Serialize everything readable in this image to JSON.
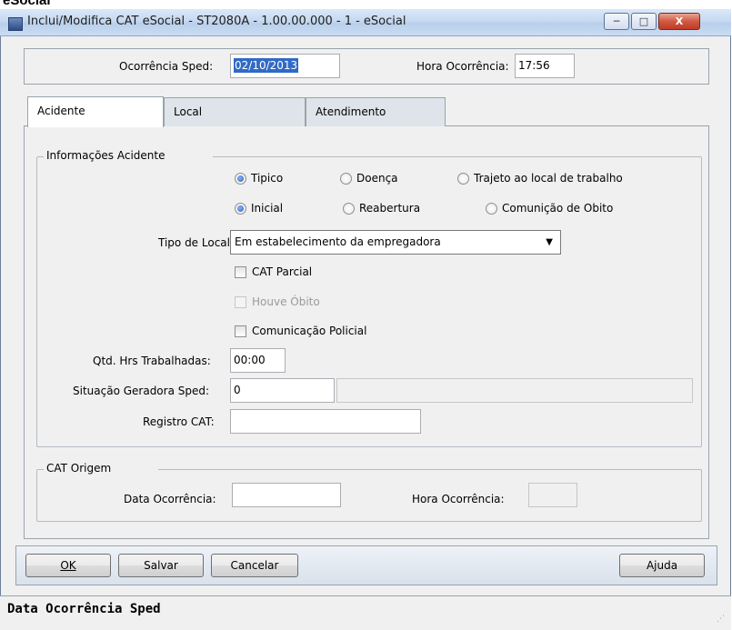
{
  "cut_top_text": "eSocial",
  "window": {
    "title": "Inclui/Modifica CAT eSocial - ST2080A - 1.00.00.000 - 1 - eSocial",
    "minimize": "─",
    "maximize": "□",
    "close": "X"
  },
  "header": {
    "ocorrencia_label": "Ocorrência Sped:",
    "ocorrencia_value": "02/10/2013",
    "hora_label": "Hora Ocorrência:",
    "hora_value": "17:56"
  },
  "tabs": [
    {
      "label": "Acidente",
      "active": true
    },
    {
      "label": "Local",
      "active": false
    },
    {
      "label": "Atendimento",
      "active": false
    }
  ],
  "acidente": {
    "legend": "Informações Acidente",
    "radios_tipo": [
      {
        "label": "Tipico",
        "checked": true
      },
      {
        "label": "Doença",
        "checked": false
      },
      {
        "label": "Trajeto ao local de trabalho",
        "checked": false
      }
    ],
    "radios_cat": [
      {
        "label": "Inicial",
        "checked": true
      },
      {
        "label": "Reabertura",
        "checked": false
      },
      {
        "label": "Comunição de Obito",
        "checked": false
      }
    ],
    "tipo_local_label": "Tipo de Local:",
    "tipo_local_value": "Em estabelecimento da empregadora",
    "cat_parcial": "CAT Parcial",
    "houve_obito": "Houve Óbito",
    "comunicacao_policial": "Comunicação Policial",
    "qtd_hrs_label": "Qtd. Hrs Trabalhadas:",
    "qtd_hrs_value": "00:00",
    "situacao_label": "Situação Geradora Sped:",
    "situacao_value": "0",
    "situacao_desc": "",
    "registro_label": "Registro CAT:",
    "registro_value": ""
  },
  "cat_origem": {
    "legend": "CAT Origem",
    "data_label": "Data Ocorrência:",
    "data_value": "",
    "hora_label": "Hora Ocorrência:",
    "hora_value": ""
  },
  "buttons": {
    "ok": "OK",
    "salvar": "Salvar",
    "cancelar": "Cancelar",
    "ajuda": "Ajuda"
  },
  "status_text": "Data Ocorrência Sped"
}
